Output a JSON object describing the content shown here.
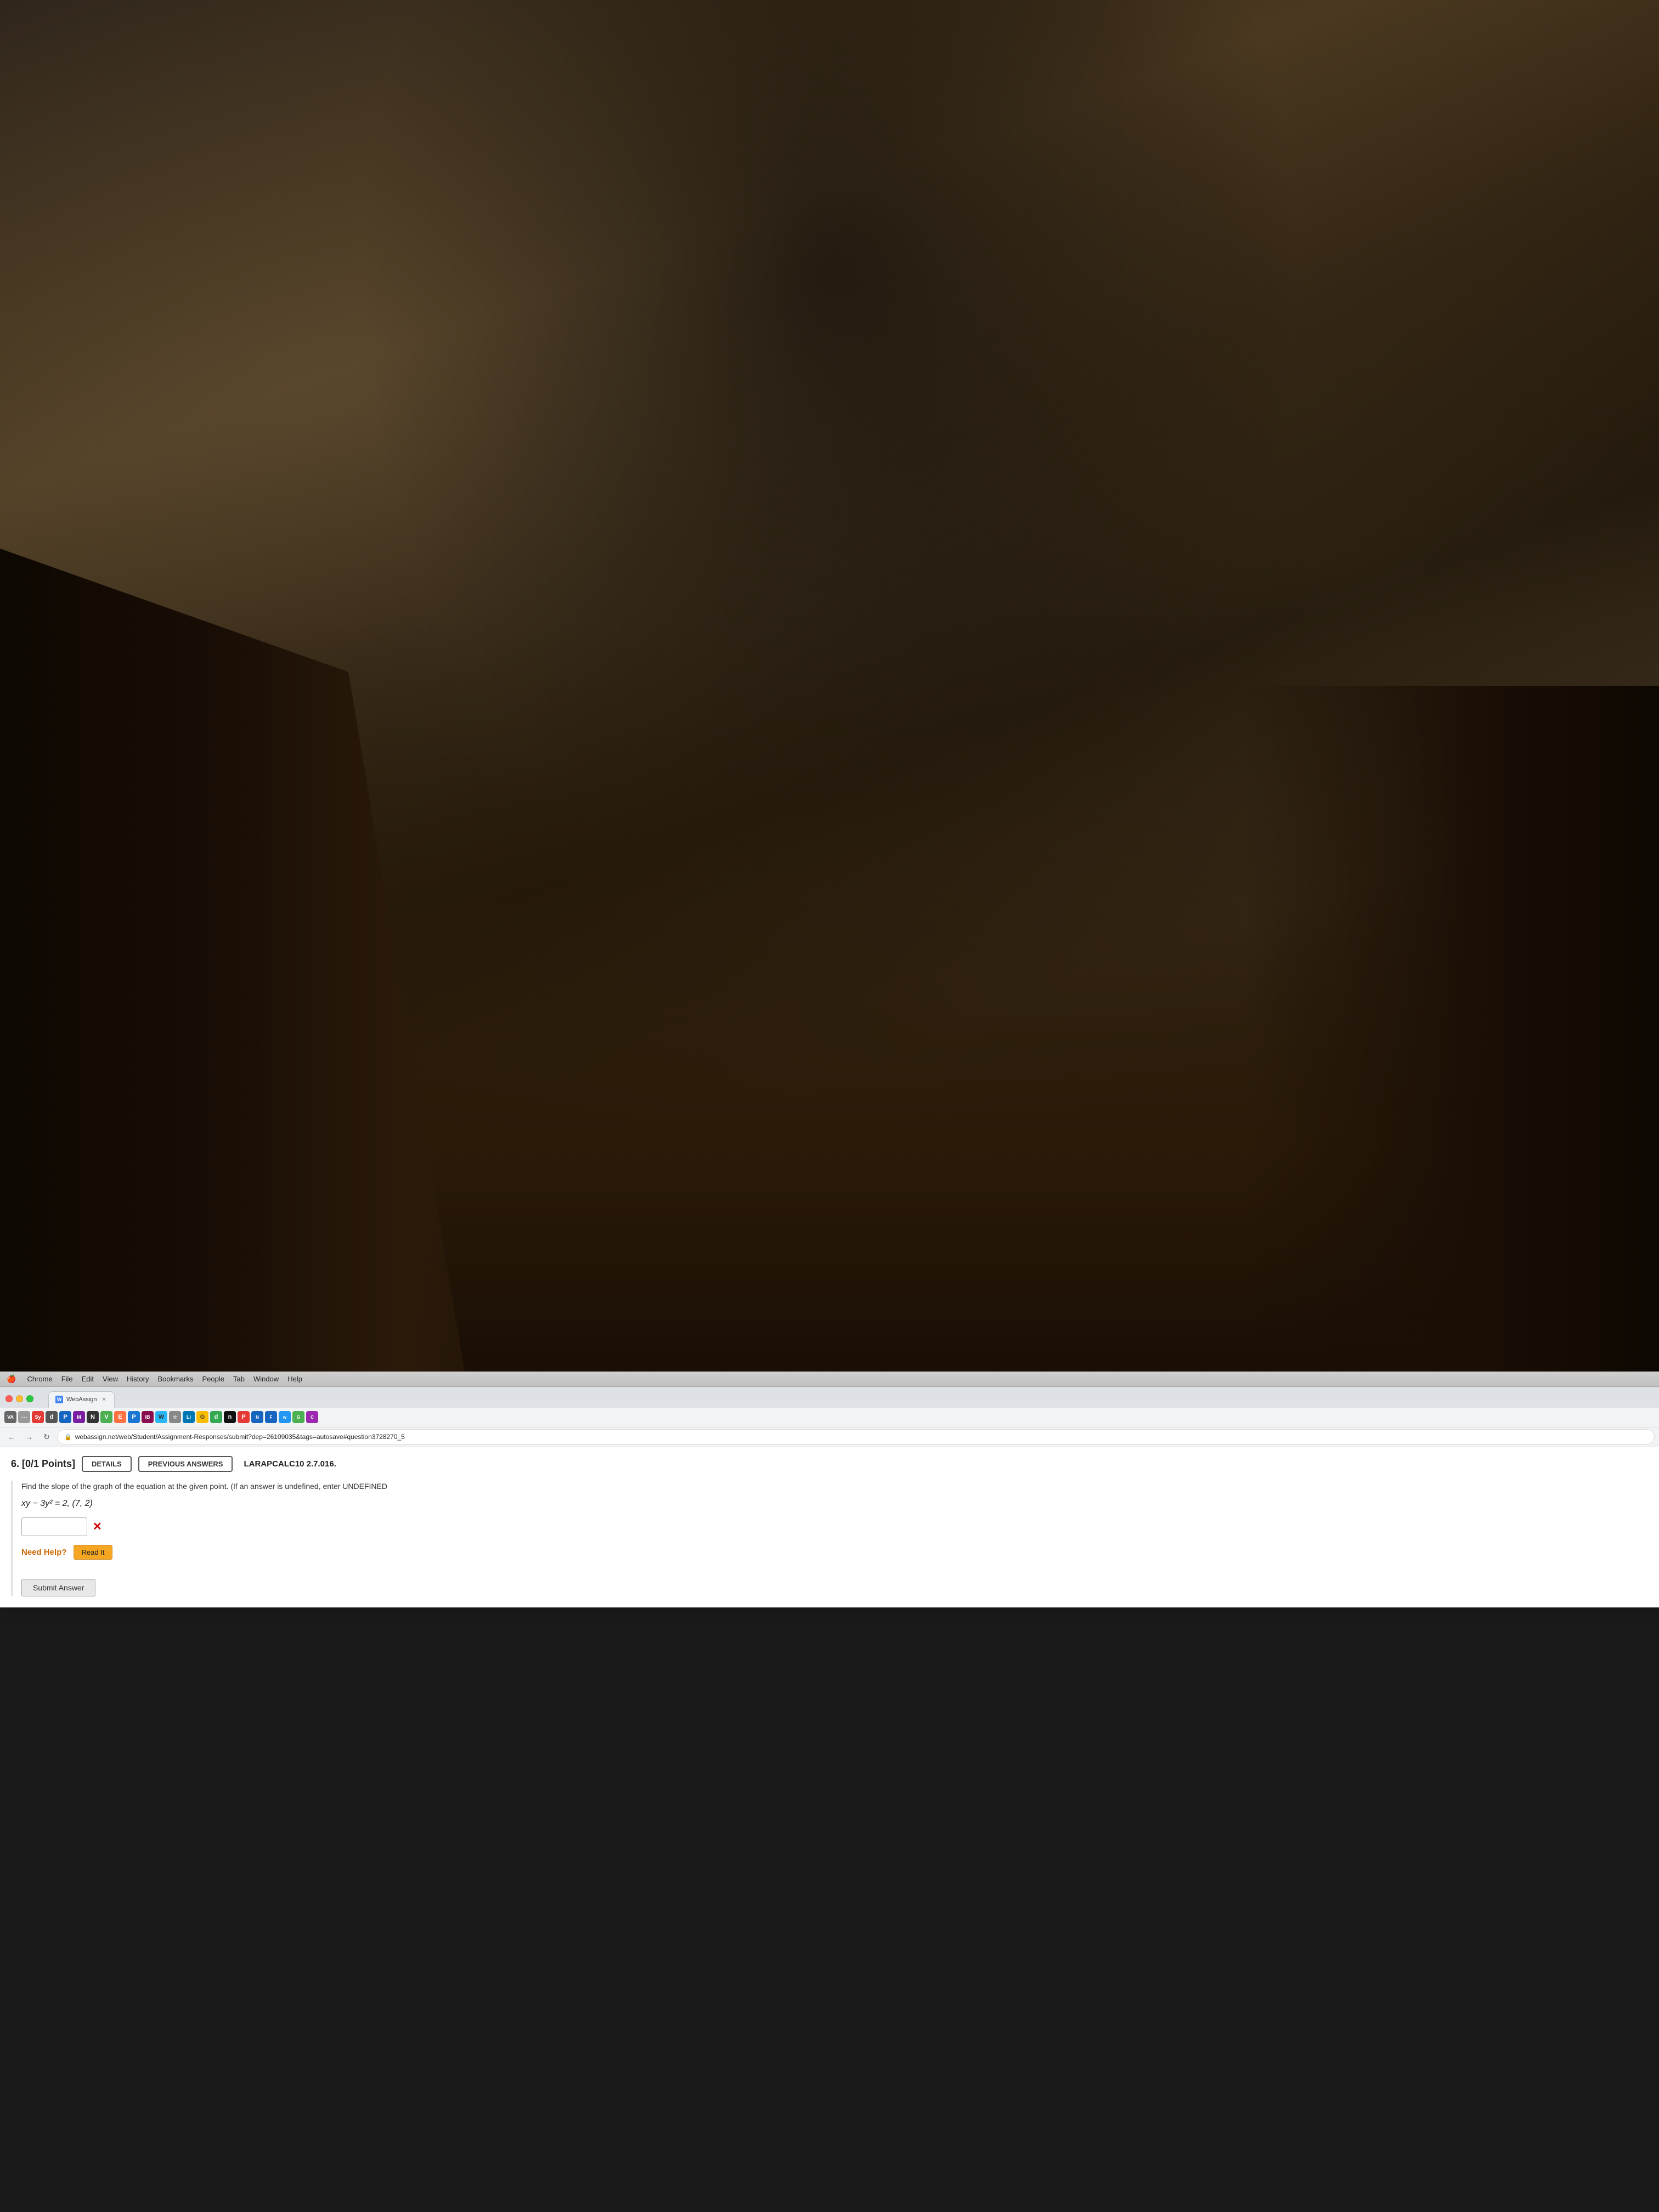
{
  "room": {
    "description": "Dark room background with wooden furniture"
  },
  "menubar": {
    "apple_symbol": "🍎",
    "items": [
      {
        "label": "Chrome"
      },
      {
        "label": "File"
      },
      {
        "label": "Edit"
      },
      {
        "label": "View"
      },
      {
        "label": "History"
      },
      {
        "label": "Bookmarks"
      },
      {
        "label": "People"
      },
      {
        "label": "Tab"
      },
      {
        "label": "Window"
      },
      {
        "label": "Help"
      }
    ]
  },
  "browser": {
    "tabs": [
      {
        "label": "WebAssign",
        "active": true,
        "favicon": "W"
      }
    ],
    "address": "webassign.net/web/Student/Assignment-Responses/submit?dep=26109035&tags=autosave#question3728270_5",
    "address_display": "webassign.net/web/Student/Assignment-Responses/submit?dep=26109035&tags=autosave#question3728270_5"
  },
  "extensions": [
    {
      "id": "va",
      "label": "VA"
    },
    {
      "id": "h",
      "label": "h"
    },
    {
      "id": "sy",
      "label": "Sy"
    },
    {
      "id": "d1",
      "label": "d"
    },
    {
      "id": "p1",
      "label": "P"
    },
    {
      "id": "mn",
      "label": "MN"
    },
    {
      "id": "ve",
      "label": "VE"
    },
    {
      "id": "p2",
      "label": "P"
    },
    {
      "id": "ib",
      "label": "IB"
    },
    {
      "id": "w",
      "label": "W"
    },
    {
      "id": "si",
      "label": "si"
    },
    {
      "id": "li",
      "label": "Li"
    },
    {
      "id": "g",
      "label": "G"
    },
    {
      "id": "d2",
      "label": "d"
    },
    {
      "id": "n",
      "label": "n"
    },
    {
      "id": "pp",
      "label": "P"
    },
    {
      "id": "af",
      "label": "N"
    },
    {
      "id": "ef",
      "label": "F"
    },
    {
      "id": "ww",
      "label": "w"
    },
    {
      "id": "oc",
      "label": "G"
    },
    {
      "id": "ci",
      "label": "C"
    }
  ],
  "question": {
    "number": "6.",
    "points": "[0/1 Points]",
    "details_label": "DETAILS",
    "previous_answers_label": "PREVIOUS ANSWERS",
    "course_label": "LARAPCALC10 2.7.016.",
    "instruction": "Find the slope of the graph of the equation at the given point. (If an answer is undefined, enter UNDEFINED",
    "equation": "xy − 3y² = 2,   (7, 2)",
    "answer_value": "",
    "answer_placeholder": "",
    "wrong_mark": "✕",
    "need_help_label": "Need Help?",
    "read_it_label": "Read It",
    "submit_label": "Submit Answer"
  }
}
